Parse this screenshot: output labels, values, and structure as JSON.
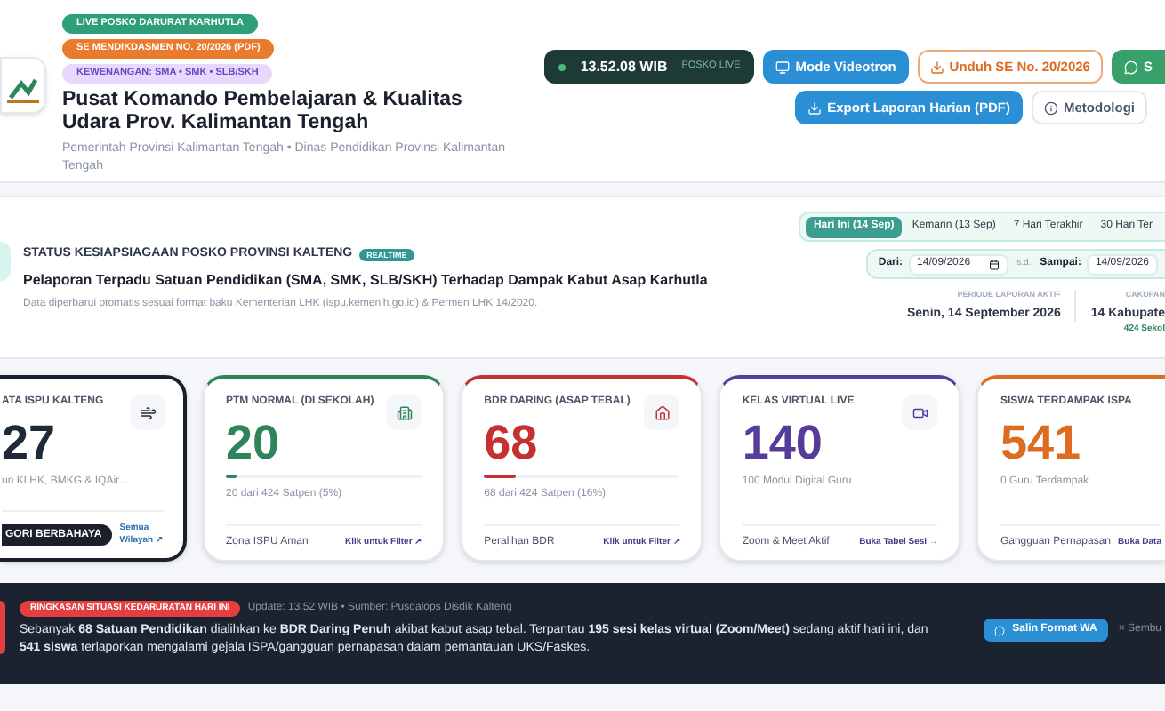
{
  "header": {
    "badges": [
      {
        "label": "LIVE POSKO DARURAT KARHUTLA",
        "color": "#2f9e7a"
      },
      {
        "label": "SE MENDIKDASMEN NO. 20/2026 (PDF)",
        "color": "#ea7a2c"
      },
      {
        "label": "KEWENANGAN: SMA • SMK • SLB/SKH",
        "color": "#e9d8fd"
      }
    ],
    "title": "Pusat Komando Pembelajaran & Kualitas Udara Prov. Kalimantan Tengah",
    "subtitle": "Pemerintah Provinsi Kalimantan Tengah • Dinas Pendidikan Provinsi Kalimantan Tengah",
    "clock": {
      "time": "13.52.08 WIB",
      "label": "POSKO LIVE"
    },
    "buttons": [
      {
        "kind": "primary",
        "label": "Mode Videotron"
      },
      {
        "kind": "outline_orange",
        "label": "Unduh SE No. 20/2026"
      },
      {
        "kind": "success",
        "label": "S"
      },
      {
        "kind": "primary",
        "label": "Export Laporan Harian (PDF)"
      },
      {
        "kind": "outline",
        "label": "Metodologi"
      }
    ]
  },
  "status": {
    "title": "STATUS KESIAPSIAGAAN POSKO PROVINSI KALTENG",
    "badge": "REALTIME",
    "heading": "Pelaporan Terpadu Satuan Pendidikan (SMA, SMK, SLB/SKH) Terhadap Dampak Kabut Asap Karhutla",
    "note": "Data diperbarui otomatis sesuai format baku Kementerian LHK (ispu.kemenlh.go.id) & Permen LHK 14/2020.",
    "tabs": [
      {
        "label": "Hari Ini (14 Sep)",
        "selected": true
      },
      {
        "label": "Kemarin (13 Sep)",
        "selected": false
      },
      {
        "label": "7 Hari Terakhir",
        "selected": false
      },
      {
        "label": "30 Hari Ter",
        "selected": false
      }
    ],
    "from_label": "Dari:",
    "from_value": "14/09/2026",
    "separator": "s.d.",
    "to_label": "Sampai:",
    "to_value": "14/09/2026",
    "period_label": "PERIODE LAPORAN AKTIF",
    "period_value": "Senin, 14 September 2026",
    "coverage_label": "CAKUPAN",
    "coverage_value": "14 Kabupate",
    "coverage_note": "424 Sekol"
  },
  "cards": [
    {
      "label": "ATA ISPU KALTENG",
      "value": "27",
      "sub": "un KLHK, BMKG & IQAir...",
      "color": "#1f2937",
      "selected": true,
      "badge": "GORI BERBAHAYA",
      "link": "Semua Wilayah ↗"
    },
    {
      "label": "PTM NORMAL (DI SEKOLAH)",
      "value": "20",
      "sub": "20 dari 424 Satpen (5%)",
      "color": "#2f855a",
      "selected": false,
      "level": 0.05,
      "footer": "Zona ISPU Aman",
      "link": "Klik untuk Filter ↗"
    },
    {
      "label": "BDR DARING (ASAP TEBAL)",
      "value": "68",
      "sub": "68 dari 424 Satpen (16%)",
      "color": "#c53030",
      "selected": false,
      "level": 0.16,
      "footer": "Peralihan BDR",
      "link": "Klik untuk Filter ↗"
    },
    {
      "label": "KELAS VIRTUAL LIVE",
      "value": "140",
      "sub": "100 Modul Digital Guru",
      "color": "#553c9a",
      "selected": false,
      "footer": "Zoom & Meet Aktif",
      "link": "Buka Tabel Sesi →"
    },
    {
      "label": "SISWA TERDAMPAK ISPA",
      "value": "541",
      "sub": "0 Guru Terdampak",
      "color": "#dd6b20",
      "selected": false,
      "footer": "Gangguan Pernapasan",
      "link": "Buka Data"
    }
  ],
  "summary": {
    "badge": "RINGKASAN SITUASI KEDARURATAN HARI INI",
    "meta": "Update: 13.52 WIB • Sumber: Pusdalops Disdik Kalteng",
    "text": "Sebanyak **68 Satuan Pendidikan** dialihkan ke **BDR Daring Penuh** akibat kabut asap tebal. Terpantau **195 sesi kelas virtual (Zoom/Meet)** sedang aktif hari ini, dan **541 siswa** terlaporkan mengalami gejala ISPA/gangguan pernapasan dalam pemantauan UKS/Faskes.",
    "copy_button": "Salin Format WA",
    "dismiss": "× Sembu"
  }
}
